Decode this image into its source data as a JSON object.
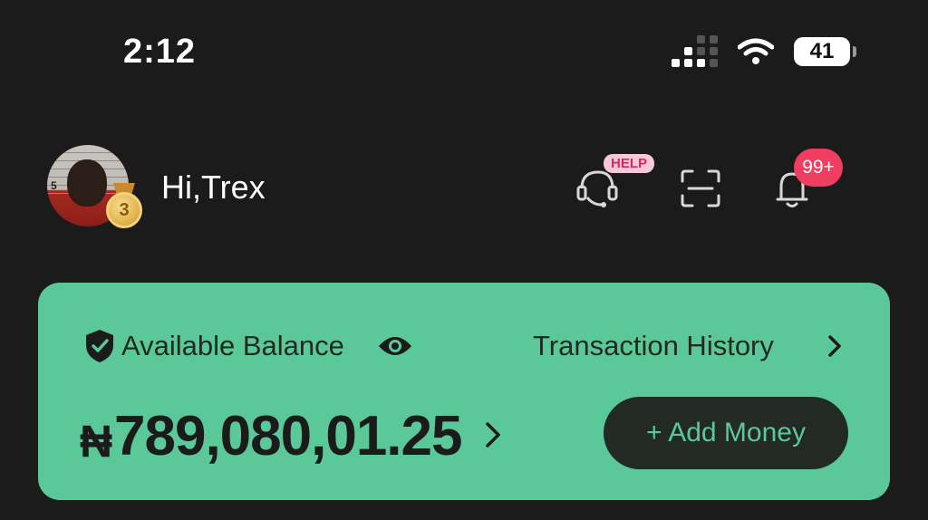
{
  "status_bar": {
    "time": "2:12",
    "battery": "41",
    "icons": [
      "cellular-signal-icon",
      "wifi-icon",
      "battery-icon"
    ]
  },
  "header": {
    "greeting": "Hi,Trex",
    "avatar_badge_level": "3",
    "help_badge": "HELP",
    "notification_count": "99+",
    "icons": [
      "customer-support-icon",
      "scan-icon",
      "bell-icon"
    ]
  },
  "balance_card": {
    "label": "Available Balance",
    "transaction_history": "Transaction History",
    "currency_symbol": "₦",
    "amount": "789,080,01.25",
    "add_money": "+ Add Money",
    "icons": [
      "shield-check-icon",
      "eye-icon",
      "chevron-right-icon"
    ]
  },
  "colors": {
    "background": "#1c1b1b",
    "card": "#5ac899",
    "button": "#232a26",
    "notification_badge": "#ef3e5f",
    "help_badge_bg": "#f7c8d8",
    "help_badge_text": "#d6285e"
  }
}
